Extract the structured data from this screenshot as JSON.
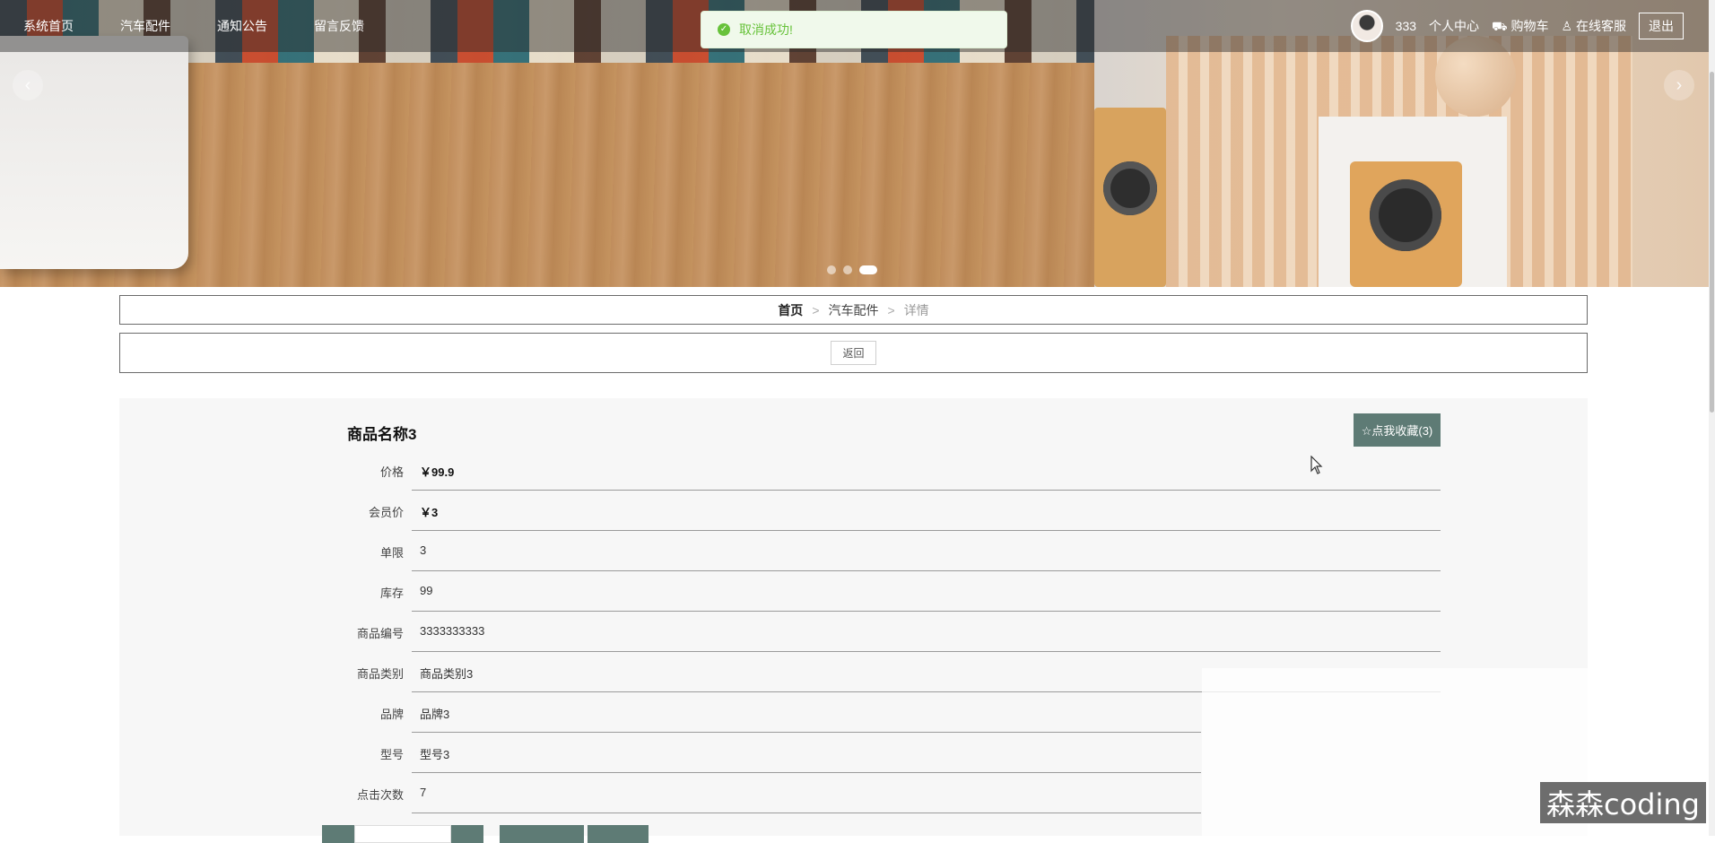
{
  "nav": {
    "items": [
      "系统首页",
      "汽车配件",
      "通知公告",
      "留言反馈"
    ],
    "username": "333",
    "profile_label": "个人中心",
    "cart_label": "⛟ 购物车",
    "service_label": "♙ 在线客服",
    "logout_label": "退出"
  },
  "toast": {
    "message": "取消成功!"
  },
  "carousel": {
    "slides": 3,
    "active_index": 2
  },
  "breadcrumb": {
    "home": "首页",
    "separator": ">",
    "category": "汽车配件",
    "current": "详情"
  },
  "back_label": "返回",
  "product": {
    "title": "商品名称3",
    "favorite_label": "☆点我收藏(3)",
    "fields": [
      {
        "label": "价格",
        "value": "￥99.9"
      },
      {
        "label": "会员价",
        "value": "￥3"
      },
      {
        "label": "单限",
        "value": "3"
      },
      {
        "label": "库存",
        "value": "99"
      },
      {
        "label": "商品编号",
        "value": "3333333333"
      },
      {
        "label": "商品类别",
        "value": "商品类别3"
      },
      {
        "label": "品牌",
        "value": "品牌3"
      },
      {
        "label": "型号",
        "value": "型号3"
      },
      {
        "label": "点击次数",
        "value": "7"
      }
    ]
  },
  "watermark": "森森coding",
  "colors": {
    "accent": "#5e7b75",
    "toast_text": "#67c23a",
    "toast_bg": "#f0f9eb"
  }
}
